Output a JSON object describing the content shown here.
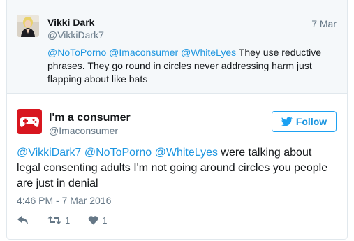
{
  "parent_tweet": {
    "name": "Vikki Dark",
    "handle": "@VikkiDark7",
    "date": "7 Mar",
    "mentions": [
      "@NoToPorno",
      "@Imaconsumer",
      "@WhiteLyes"
    ],
    "text": "They use reductive phrases. They go round in circles never addressing harm just flapping about like bats"
  },
  "main_tweet": {
    "name": "I'm a consumer",
    "handle": "@Imaconsumer",
    "follow_label": "Follow",
    "mentions": [
      "@VikkiDark7",
      "@NoToPorno",
      "@WhiteLyes"
    ],
    "text_line1": "were talking about",
    "text_rest": "legal consenting adults I'm not going around circles you people are just in denial",
    "timestamp": "4:46 PM - 7 Mar 2016",
    "retweet_count": "1",
    "like_count": "1"
  },
  "colors": {
    "link": "#1b95e0",
    "follow_border": "#1da1f2",
    "avatar_red": "#d8161f",
    "muted": "#657786"
  },
  "icons": [
    "reply-icon",
    "retweet-icon",
    "heart-icon",
    "twitter-bird-icon",
    "gamepad-icon"
  ]
}
